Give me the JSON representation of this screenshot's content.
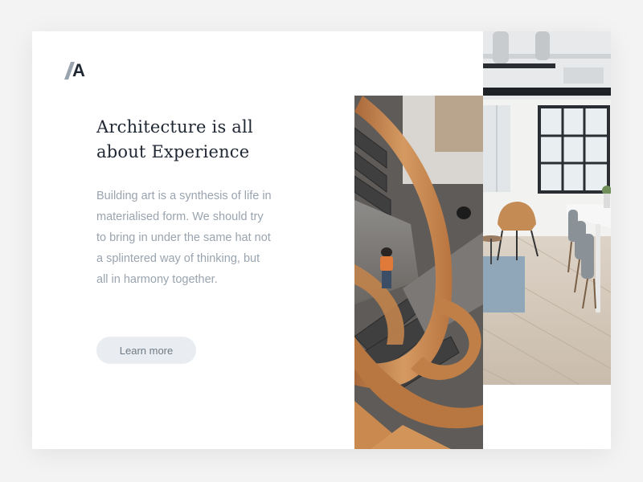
{
  "logo": {
    "letter": "A",
    "icon": "brand-logo-icon"
  },
  "hero": {
    "title_line1": "Architecture is all",
    "title_line2": "about Experience",
    "body_lines": [
      "Building art is a synthesis of life in",
      "materialised form. We should try",
      "to bring in under the same hat not",
      "a splintered way of thinking, but",
      "all in harmony together."
    ],
    "cta_label": "Learn more"
  },
  "images": {
    "left": "spiral-wooden-staircase-photo",
    "right": "office-interior-photo"
  },
  "colors": {
    "background": "#f3f3f3",
    "card": "#ffffff",
    "headline": "#1f2733",
    "body": "#9aa4af",
    "button_bg": "#e9edf1",
    "button_text": "#6e7a86",
    "wood": "#c8874f"
  }
}
